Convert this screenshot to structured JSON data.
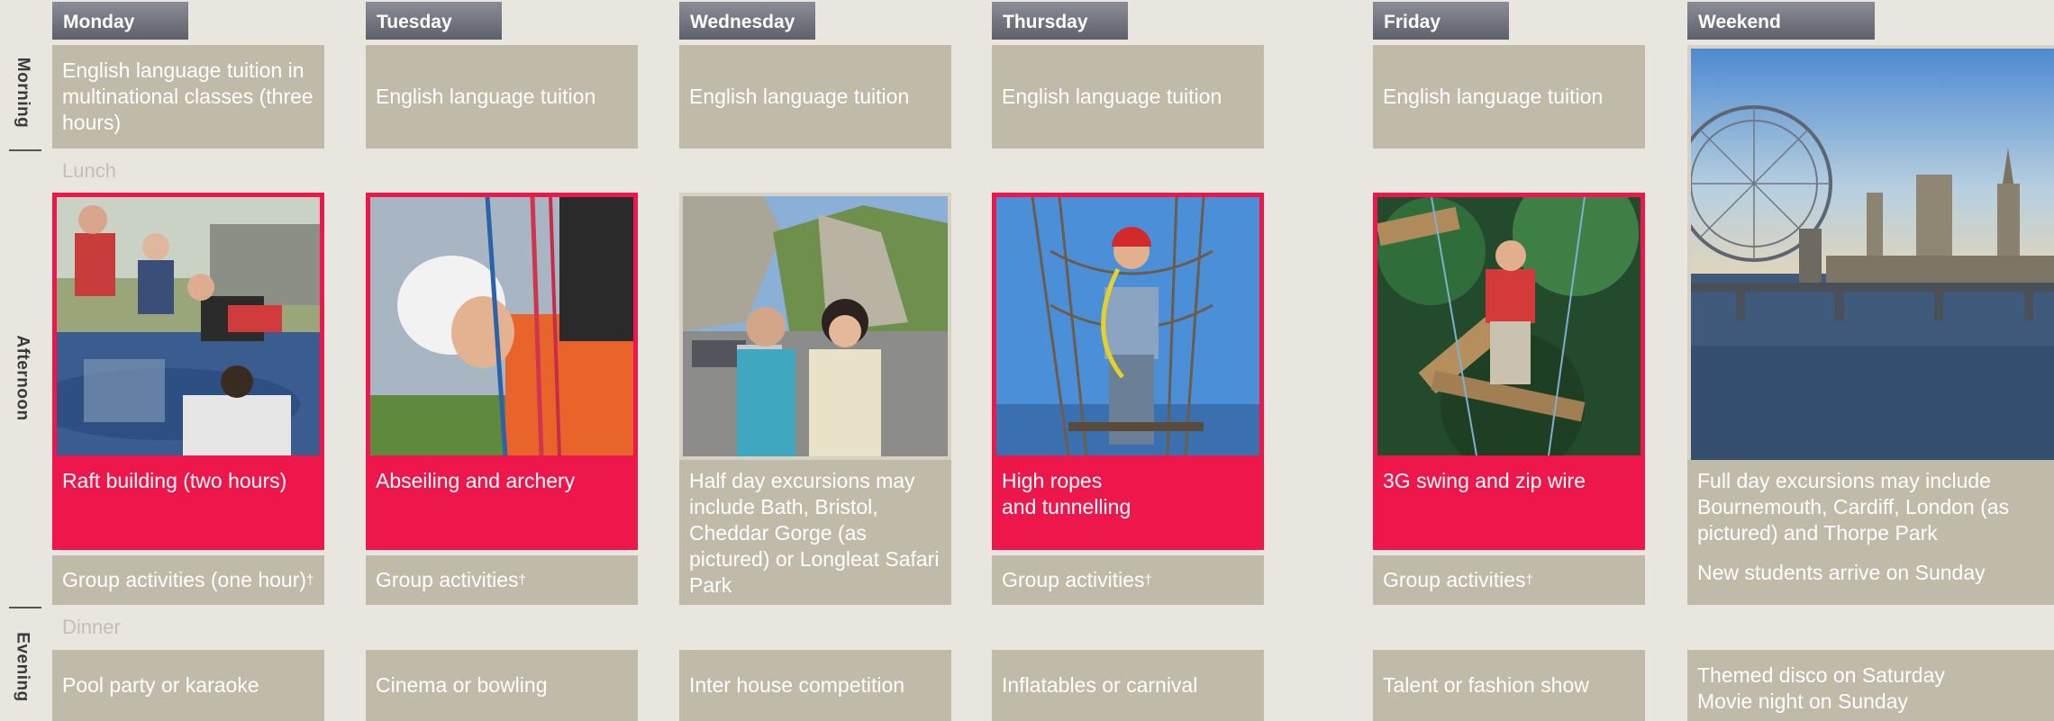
{
  "sections": {
    "morning": "Morning",
    "afternoon": "Afternoon",
    "evening": "Evening"
  },
  "breaks": {
    "lunch": "Lunch",
    "dinner": "Dinner"
  },
  "days": [
    {
      "name": "Monday",
      "morning": "English language tuition in multinational classes (three hours)",
      "afternoon": "Raft building (two hours)",
      "group": "Group activities (one hour)",
      "evening": "Pool party or karaoke"
    },
    {
      "name": "Tuesday",
      "morning": "English language tuition",
      "afternoon": "Abseiling and archery",
      "group": "Group activities",
      "evening": "Cinema or bowling"
    },
    {
      "name": "Wednesday",
      "morning": "English language tuition",
      "afternoon": "Half day excursions may include Bath, Bristol, Cheddar Gorge (as pictured) or Longleat Safari Park",
      "evening": "Inter house competition"
    },
    {
      "name": "Thursday",
      "morning": "English language tuition",
      "afternoon": "High ropes and tunnelling",
      "group": "Group activities",
      "evening": "Inflatables or carnival"
    },
    {
      "name": "Friday",
      "morning": "English language tuition",
      "afternoon": "3G swing and zip wire",
      "group": "Group activities",
      "evening": "Talent or fashion show"
    },
    {
      "name": "Weekend",
      "afternoon": "Full day excursions may include Bournemouth, Cardiff, London (as pictured) and Thorpe Park",
      "arrival": "New students arrive on Sunday",
      "evening_line1": "Themed disco on Saturday",
      "evening_line2": "Movie night on Sunday"
    }
  ],
  "dagger": "†",
  "colors": {
    "accent_red": "#ee174b",
    "cell_grey": "#c0baa8",
    "background": "#e8e6df",
    "tab_grey": "#6f717b"
  },
  "photos": [
    "raft-building-photo",
    "abseiling-photo",
    "cheddar-gorge-photo",
    "high-ropes-photo",
    "zip-wire-photo",
    "london-eye-photo"
  ]
}
